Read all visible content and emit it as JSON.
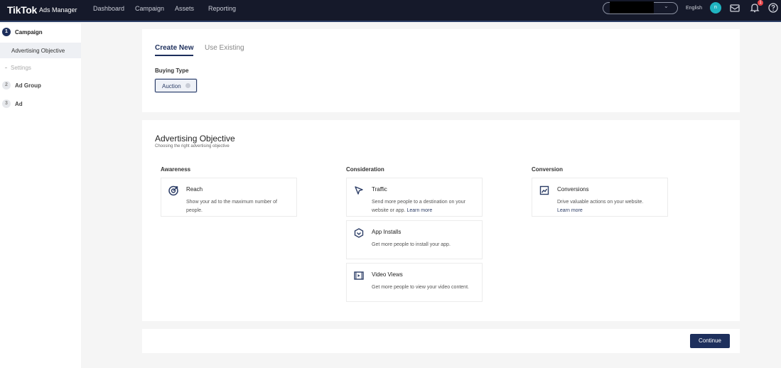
{
  "topbar": {
    "logo": "TikTok",
    "logo_sub": "Ads Manager",
    "nav": [
      "Dashboard",
      "Campaign",
      "Assets",
      "Reporting"
    ],
    "language": "English",
    "avatar_initial": "n",
    "notification_count": "1",
    "icons": [
      "chevron-down-icon",
      "mail-icon",
      "bell-icon",
      "help-icon"
    ]
  },
  "sidebar": {
    "steps": [
      {
        "num": "1",
        "label": "Campaign"
      },
      {
        "num": "2",
        "label": "Ad Group"
      },
      {
        "num": "3",
        "label": "Ad"
      }
    ],
    "sub_items": [
      "Advertising Objective",
      "Settings"
    ]
  },
  "campaign": {
    "tabs": [
      "Create New",
      "Use Existing"
    ],
    "buying_type_label": "Buying Type",
    "buying_type_value": "Auction"
  },
  "objective": {
    "title": "Advertising Objective",
    "subtitle": "Choosing the right advertising objective",
    "columns": [
      "Awareness",
      "Consideration",
      "Conversion"
    ],
    "items": {
      "reach": {
        "name": "Reach",
        "desc": "Show your ad to the maximum number of people."
      },
      "traffic": {
        "name": "Traffic",
        "desc": "Send more people to a destination on your website or app.",
        "learn": "Learn more"
      },
      "app_installs": {
        "name": "App Installs",
        "desc": "Get more people to install your app."
      },
      "video_views": {
        "name": "Video Views",
        "desc": "Get more people to view your video content."
      },
      "conversions": {
        "name": "Conversions",
        "desc": "Drive valuable actions on your website.",
        "learn": "Learn more"
      }
    }
  },
  "footer": {
    "continue_label": "Continue"
  },
  "colors": {
    "brand_navy": "#1d2f5c",
    "topbar": "#15192a",
    "avatar": "#20b4c0",
    "badge": "#e9464a"
  }
}
